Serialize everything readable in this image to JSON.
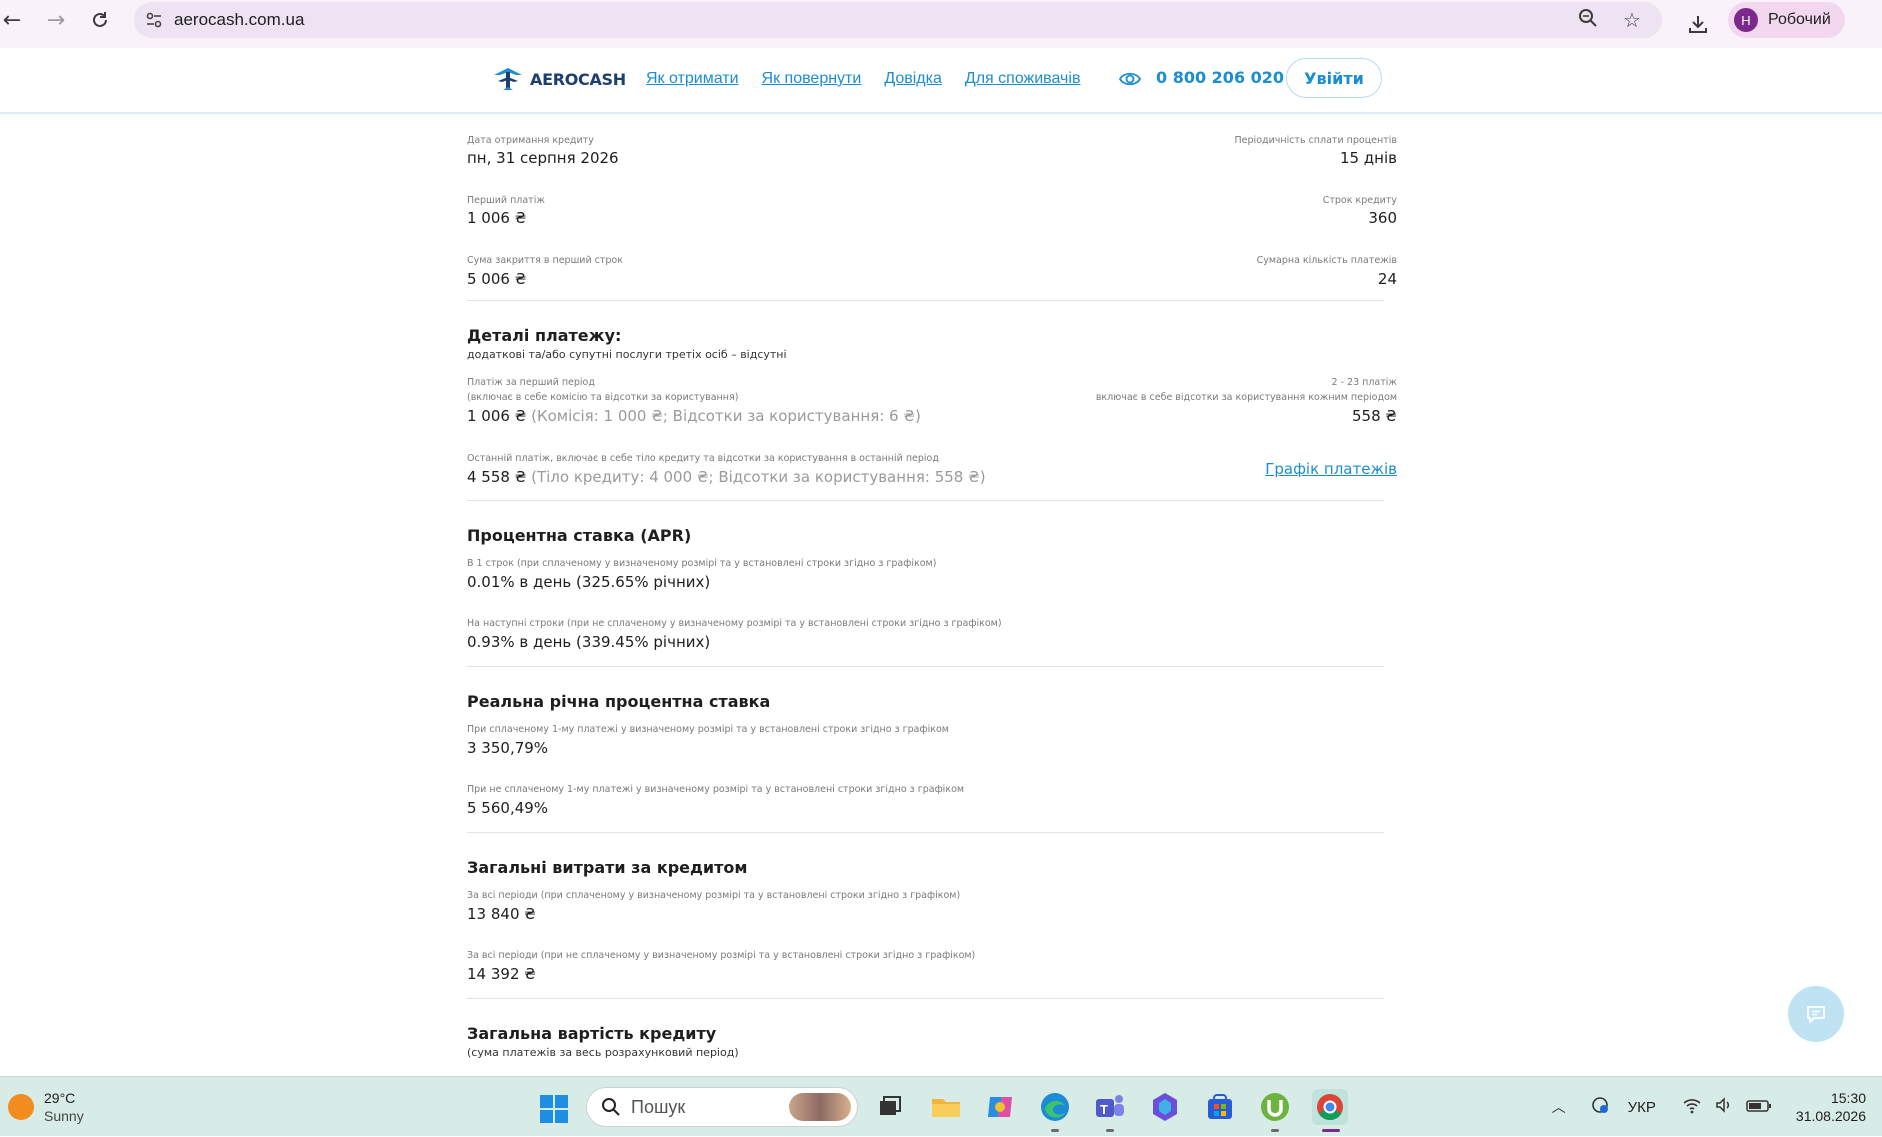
{
  "browser": {
    "url": "aerocash.com.ua",
    "profile_initial": "Н",
    "profile_label": "Робочий"
  },
  "header": {
    "logo_text": "AEROCASH",
    "nav": [
      "Як отримати",
      "Як повернути",
      "Довідка",
      "Для споживачів"
    ],
    "phone": "0 800 206 020",
    "login_label": "Увійти"
  },
  "summary": [
    {
      "left_label": "Дата отримання кредиту",
      "left_value": "пн, 31 серпня 2026",
      "right_label": "Періодичність сплати процентів",
      "right_value": "15 днів"
    },
    {
      "left_label": "Перший платіж",
      "left_value": "1 006 ₴",
      "right_label": "Строк кредиту",
      "right_value": "360"
    },
    {
      "left_label": "Сума закриття в перший строк",
      "left_value": "5 006 ₴",
      "right_label": "Сумарна кількість платежів",
      "right_value": "24"
    }
  ],
  "payment_details": {
    "title": "Деталі платежу:",
    "subtitle": "додаткові та/або супутні послуги третіх осіб – відсутні",
    "first_label_1": "Платіж за перший період",
    "first_label_2": "(включає в себе комісію та відсотки за користування)",
    "first_value": "1 006 ₴",
    "first_value_note": "(Комісія: 1 000 ₴; Відсотки за користування: 6 ₴)",
    "mid_label_1": "2 - 23 платіж",
    "mid_label_2": "включає в себе відсотки за користування кожним періодом",
    "mid_value": "558 ₴",
    "last_label": "Останній платіж, включає в себе тіло кредиту та відсотки за користування в останній період",
    "last_value": "4 558 ₴",
    "last_value_note": "(Тіло кредиту: 4 000 ₴; Відсотки за користування: 558 ₴)",
    "schedule_link": "Графік платежів"
  },
  "apr": {
    "title": "Процентна ставка (APR)",
    "label_1": "В 1 строк (при сплаченому у визначеному розмірі та у встановлені строки згідно з графіком)",
    "value_1": "0.01% в день (325.65% річних)",
    "label_2": "На наступні строки (при не сплаченому у визначеному розмірі та у встановлені строки згідно з графіком)",
    "value_2": "0.93% в день (339.45% річних)"
  },
  "real_rate": {
    "title": "Реальна річна процентна ставка",
    "label_1": "При сплаченому 1-му платежі у визначеному розмірі та у встановлені строки згідно з графіком",
    "value_1": "3 350,79%",
    "label_2": "При не сплаченому 1-му платежі у визначеному розмірі та у встановлені строки згідно з графіком",
    "value_2": "5 560,49%"
  },
  "total_costs": {
    "title": "Загальні витрати за кредитом",
    "label_1": "За всі періоди (при сплаченому у визначеному розмірі та у встановлені строки згідно з графіком)",
    "value_1": "13 840 ₴",
    "label_2": "За всі періоди (при не сплаченому у визначеному розмірі та у встановлені строки згідно з графіком)",
    "value_2": "14 392 ₴"
  },
  "total_value": {
    "title": "Загальна вартість кредиту",
    "subtitle": "(сума платежів за весь розрахунковий період)"
  },
  "taskbar": {
    "temp": "29°C",
    "condition": "Sunny",
    "search_placeholder": "Пошук",
    "lang": "УКР",
    "time": "15:30",
    "date": "31.08.2026"
  },
  "colors": {
    "accent": "#1b8ed1",
    "logo": "#1c3f6e"
  }
}
